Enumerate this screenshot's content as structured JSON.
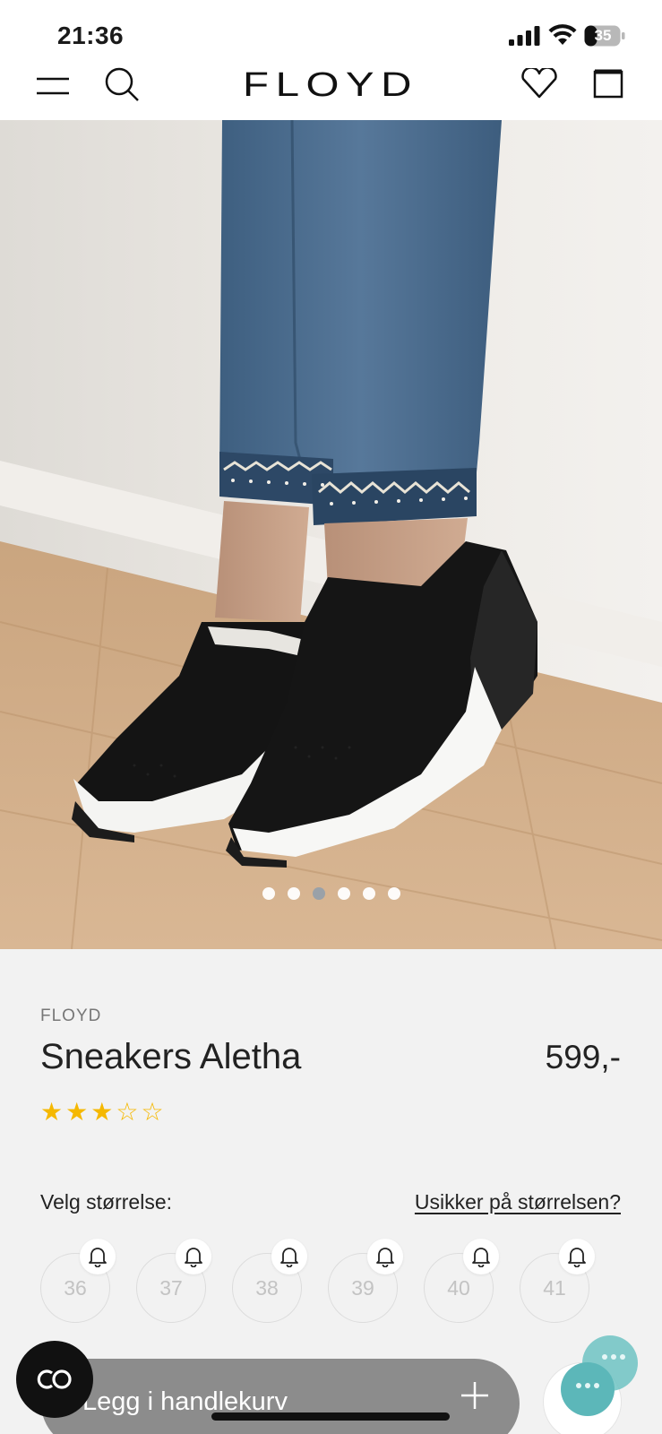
{
  "status_bar": {
    "time": "21:36",
    "battery": "35"
  },
  "header": {
    "brand": "FLOYD",
    "icons": [
      "menu-icon",
      "search-icon",
      "heart-icon",
      "bag-icon"
    ]
  },
  "gallery": {
    "image_count": 6,
    "active_index": 2
  },
  "product": {
    "brand": "FLOYD",
    "name": "Sneakers Aletha",
    "price": "599,-",
    "rating": 3,
    "rating_max": 5
  },
  "size_selector": {
    "label": "Velg størrelse:",
    "help_link": "Usikker på størrelsen?",
    "sizes": [
      "36",
      "37",
      "38",
      "39",
      "40",
      "41"
    ]
  },
  "actions": {
    "add_to_cart": "Legg i handlekurv"
  },
  "colors": {
    "star": "#f5b800",
    "cart_button": "#8c8c8c",
    "chat": "#5cb7b9"
  }
}
